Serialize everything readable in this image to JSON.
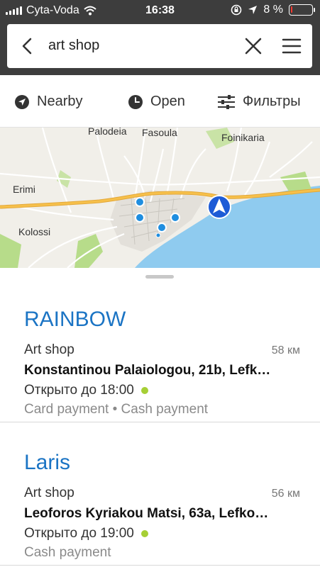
{
  "status_bar": {
    "carrier": "Cyta-Voda",
    "time": "16:38",
    "battery": "8 %",
    "battery_level": 0.08
  },
  "search": {
    "query": "art shop",
    "icons": [
      "back-arrow-icon",
      "close-icon",
      "menu-icon"
    ]
  },
  "filters": {
    "nearby_label": "Nearby",
    "open_label": "Open",
    "filters_label": "Фильтры"
  },
  "map": {
    "places": [
      "Palodeia",
      "Fasoula",
      "Foinikaria",
      "Erimi",
      "Kolossi"
    ],
    "colors": {
      "land": "#f1efe9",
      "sea": "#8fcbef",
      "park": "#b7dc8a",
      "highway": "#f2b22e",
      "pin": "#1f8ee0",
      "location": "#1d5bd6"
    }
  },
  "results": [
    {
      "name": "RAINBOW",
      "type": "Art shop",
      "distance": "58 км",
      "address": "Konstantinou Palaiologou, 21b, Lefk…",
      "hours": "Открыто до 18:00",
      "payment": "Card payment • Cash payment"
    },
    {
      "name": "Laris",
      "type": "Art shop",
      "distance": "56 км",
      "address": "Leoforos Kyriakou Matsi, 63a, Lefko…",
      "hours": "Открыто до 19:00",
      "payment": "Cash payment"
    }
  ]
}
